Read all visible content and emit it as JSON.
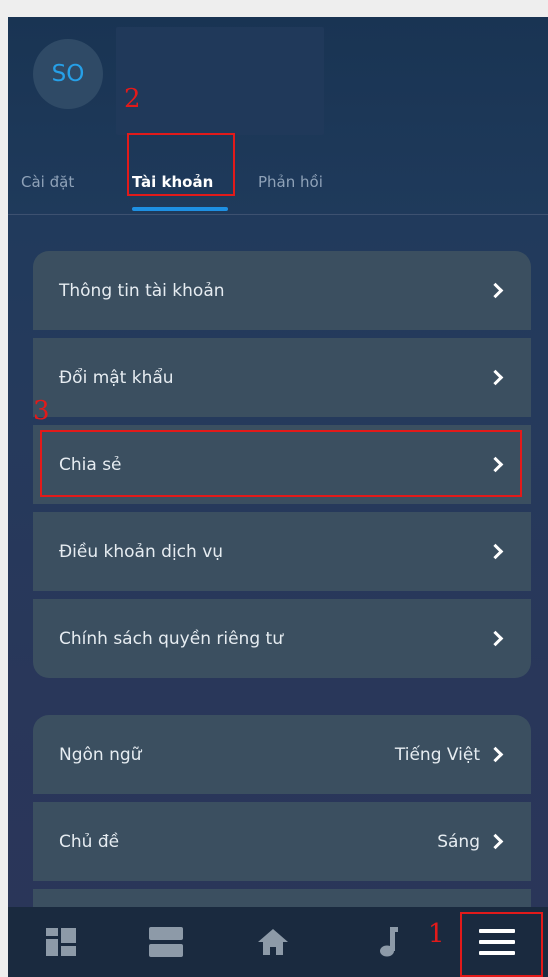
{
  "header": {
    "avatar_initials": "SO"
  },
  "tabs": [
    {
      "label": "Cài đặt",
      "active": false
    },
    {
      "label": "Tài khoản",
      "active": true
    },
    {
      "label": "Phản hồi",
      "active": false
    }
  ],
  "account_menu": [
    {
      "label": "Thông tin tài khoản"
    },
    {
      "label": "Đổi mật khẩu"
    },
    {
      "label": "Chia sẻ"
    },
    {
      "label": "Điều khoản dịch vụ"
    },
    {
      "label": "Chính sách quyền riêng tư"
    }
  ],
  "preferences_menu": [
    {
      "label": "Ngôn ngữ",
      "value": "Tiếng Việt"
    },
    {
      "label": "Chủ đề",
      "value": "Sáng"
    }
  ],
  "bottom_nav": [
    {
      "icon": "dashboard-icon"
    },
    {
      "icon": "list-view-icon"
    },
    {
      "icon": "home-icon"
    },
    {
      "icon": "music-note-icon"
    },
    {
      "icon": "hamburger-menu-icon"
    }
  ],
  "annotations": {
    "step1": "1",
    "step2": "2",
    "step3": "3",
    "color": "#e21a1a"
  },
  "colors": {
    "accent": "#1e90e3",
    "avatar_text": "#26a0e8",
    "menu_item_bg": "#3b4f60"
  }
}
